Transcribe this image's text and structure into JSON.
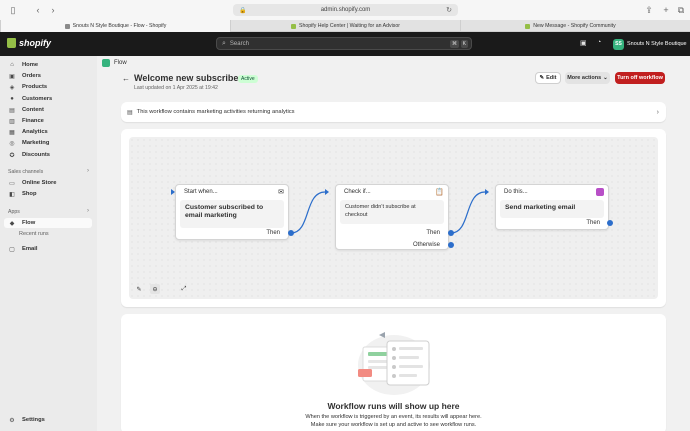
{
  "browser": {
    "url": "admin.shopify.com",
    "tabs": [
      {
        "title": "Snouts N Style Boutique - Flow - Shopify",
        "active": true,
        "favicon_color": "#8a8a8a"
      },
      {
        "title": "Shopify Help Center | Waiting for an Advisor",
        "active": false,
        "favicon_color": "#95bf47"
      },
      {
        "title": "New Message - Shopify Community",
        "active": false,
        "favicon_color": "#95bf47"
      }
    ]
  },
  "topbar": {
    "logo_text": "shopify",
    "search_placeholder": "Search",
    "shortcut_keys": [
      "⌘",
      "K"
    ],
    "store_initials": "SS",
    "store_name": "Snouts N Style Boutique"
  },
  "sidebar": {
    "items": [
      {
        "label": "Home",
        "icon": "home-icon",
        "glyph": "⌂"
      },
      {
        "label": "Orders",
        "icon": "orders-icon",
        "glyph": "▣"
      },
      {
        "label": "Products",
        "icon": "products-icon",
        "glyph": "◈"
      },
      {
        "label": "Customers",
        "icon": "customers-icon",
        "glyph": "●"
      },
      {
        "label": "Content",
        "icon": "content-icon",
        "glyph": "▤"
      },
      {
        "label": "Finance",
        "icon": "finance-icon",
        "glyph": "▥"
      },
      {
        "label": "Analytics",
        "icon": "analytics-icon",
        "glyph": "▦"
      },
      {
        "label": "Marketing",
        "icon": "marketing-icon",
        "glyph": "◎"
      },
      {
        "label": "Discounts",
        "icon": "discounts-icon",
        "glyph": "✪"
      }
    ],
    "sales_channels_label": "Sales channels",
    "channels": [
      {
        "label": "Online Store",
        "icon": "online-store-icon",
        "glyph": "▭"
      },
      {
        "label": "Shop",
        "icon": "shop-icon",
        "glyph": "◧"
      }
    ],
    "apps_label": "Apps",
    "apps": [
      {
        "label": "Flow",
        "icon": "flow-icon",
        "glyph": "◆"
      }
    ],
    "apps_sub": "Recent runs",
    "email": {
      "label": "Email",
      "icon": "email-icon",
      "glyph": "▢"
    },
    "settings": {
      "label": "Settings",
      "icon": "settings-icon",
      "glyph": "⚙"
    }
  },
  "page": {
    "breadcrumb": "Flow",
    "title": "Welcome new subscribers",
    "status": "Active",
    "updated": "Last updated on 1 Apr 2025 at 19:42",
    "edit_label": "Edit",
    "more_label": "More actions",
    "turn_off_label": "Turn off workflow",
    "info_text": "This workflow contains marketing activities returning analytics"
  },
  "workflow": {
    "trigger": {
      "head": "Start when...",
      "body": "Customer subscribed to email marketing",
      "port": "Then"
    },
    "condition": {
      "head": "Check if...",
      "body": "Customer didn't subscribe at checkout",
      "port_then": "Then",
      "port_otherwise": "Otherwise"
    },
    "action": {
      "head": "Do this...",
      "body": "Send marketing email",
      "port": "Then"
    }
  },
  "empty_state": {
    "title": "Workflow runs will show up here",
    "line1": "When the workflow is triggered by an event, its results will appear here.",
    "line2": "Make sure your workflow is set up and active to see workflow runs."
  },
  "colors": {
    "accent": "#2c6ecb",
    "danger": "#c11f1f",
    "active_badge_bg": "#cdfed4"
  }
}
